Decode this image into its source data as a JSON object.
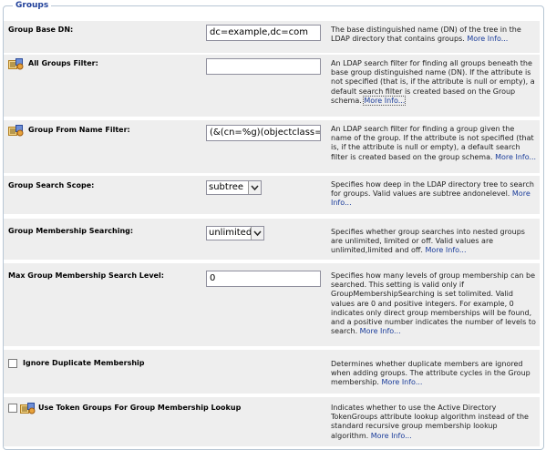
{
  "section": {
    "legend": "Groups"
  },
  "rows": [
    {
      "label": "Group Base DN:",
      "has_icon": false,
      "control": "text",
      "value": "dc=example,dc=com",
      "desc": "The base distinguished name (DN) of the tree in the LDAP directory that contains groups.",
      "more": "More Info..."
    },
    {
      "label": "All Groups Filter:",
      "has_icon": true,
      "icon": "property-sheet-icon",
      "control": "text",
      "value": "",
      "desc": "An LDAP search filter for finding all groups beneath the base group distinguished name (DN). If the attribute is not specified (that is, if the attribute is null or empty), a default search filter is created based on the Group schema.",
      "more": "More Info..."
    },
    {
      "label": "Group From Name Filter:",
      "has_icon": true,
      "icon": "property-sheet-icon",
      "control": "text",
      "value": "(&(cn=%g)(objectclass=g",
      "desc": "An LDAP search filter for finding a group given the name of the group. If the attribute is not specified (that is, if the attribute is null or empty), a default search filter is created based on the group schema.",
      "more": "More Info..."
    },
    {
      "label": "Group Search Scope:",
      "has_icon": false,
      "control": "select",
      "value": "subtree",
      "desc": "Specifies how deep in the LDAP directory tree to search for groups. Valid values are subtree andonelevel.",
      "more": "More Info..."
    },
    {
      "label": "Group Membership Searching:",
      "has_icon": false,
      "control": "select",
      "value": "unlimited",
      "desc": "Specifies whether group searches into nested groups are unlimited, limited or off. Valid values are unlimited,limited and off.",
      "more": "More Info..."
    },
    {
      "label": "Max Group Membership Search Level:",
      "has_icon": false,
      "control": "text",
      "value": "0",
      "desc": "Specifies how many levels of group membership can be searched. This setting is valid only if GroupMembershipSearching is set tolimited. Valid values are 0 and positive integers. For example, 0 indicates only direct group memberships will be found, and a positive number indicates the number of levels to search.",
      "more": "More Info..."
    },
    {
      "label": "Ignore Duplicate Membership",
      "has_icon": false,
      "control": "checkbox",
      "checked": false,
      "desc": "Determines whether duplicate members are ignored when adding groups. The attribute cycles in the Group membership.",
      "more": "More Info..."
    },
    {
      "label": "Use Token Groups For Group Membership Lookup",
      "has_icon": true,
      "icon": "property-sheet-icon",
      "control": "checkbox",
      "checked": false,
      "desc": "Indicates whether to use the Active Directory TokenGroups attribute lookup algorithm instead of the standard recursive group membership lookup algorithm.",
      "more": "More Info..."
    }
  ],
  "colors": {
    "row_bg": "#eeeeee",
    "legend": "#20409a",
    "link": "#1a3c9a",
    "frame": "#b7c6d4"
  }
}
